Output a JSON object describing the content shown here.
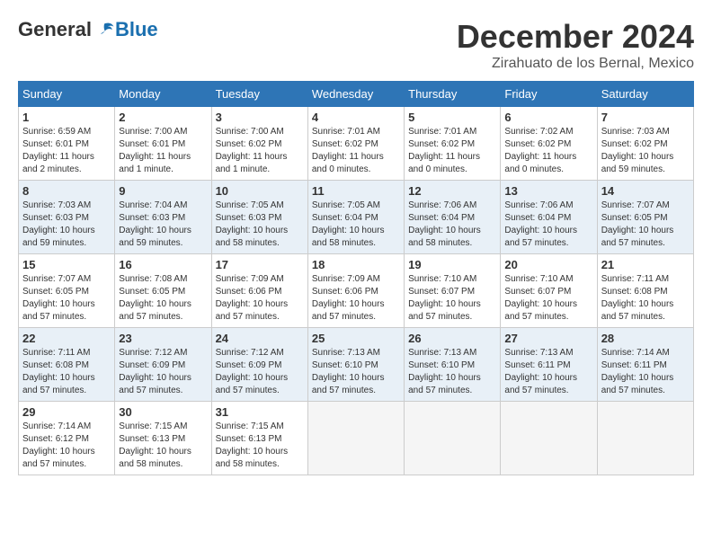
{
  "logo": {
    "general": "General",
    "blue": "Blue"
  },
  "title": "December 2024",
  "location": "Zirahuato de los Bernal, Mexico",
  "weekdays": [
    "Sunday",
    "Monday",
    "Tuesday",
    "Wednesday",
    "Thursday",
    "Friday",
    "Saturday"
  ],
  "weeks": [
    [
      {
        "day": "1",
        "sunrise": "6:59 AM",
        "sunset": "6:01 PM",
        "daylight": "11 hours and 2 minutes."
      },
      {
        "day": "2",
        "sunrise": "7:00 AM",
        "sunset": "6:01 PM",
        "daylight": "11 hours and 1 minute."
      },
      {
        "day": "3",
        "sunrise": "7:00 AM",
        "sunset": "6:02 PM",
        "daylight": "11 hours and 1 minute."
      },
      {
        "day": "4",
        "sunrise": "7:01 AM",
        "sunset": "6:02 PM",
        "daylight": "11 hours and 0 minutes."
      },
      {
        "day": "5",
        "sunrise": "7:01 AM",
        "sunset": "6:02 PM",
        "daylight": "11 hours and 0 minutes."
      },
      {
        "day": "6",
        "sunrise": "7:02 AM",
        "sunset": "6:02 PM",
        "daylight": "11 hours and 0 minutes."
      },
      {
        "day": "7",
        "sunrise": "7:03 AM",
        "sunset": "6:02 PM",
        "daylight": "10 hours and 59 minutes."
      }
    ],
    [
      {
        "day": "8",
        "sunrise": "7:03 AM",
        "sunset": "6:03 PM",
        "daylight": "10 hours and 59 minutes."
      },
      {
        "day": "9",
        "sunrise": "7:04 AM",
        "sunset": "6:03 PM",
        "daylight": "10 hours and 59 minutes."
      },
      {
        "day": "10",
        "sunrise": "7:05 AM",
        "sunset": "6:03 PM",
        "daylight": "10 hours and 58 minutes."
      },
      {
        "day": "11",
        "sunrise": "7:05 AM",
        "sunset": "6:04 PM",
        "daylight": "10 hours and 58 minutes."
      },
      {
        "day": "12",
        "sunrise": "7:06 AM",
        "sunset": "6:04 PM",
        "daylight": "10 hours and 58 minutes."
      },
      {
        "day": "13",
        "sunrise": "7:06 AM",
        "sunset": "6:04 PM",
        "daylight": "10 hours and 57 minutes."
      },
      {
        "day": "14",
        "sunrise": "7:07 AM",
        "sunset": "6:05 PM",
        "daylight": "10 hours and 57 minutes."
      }
    ],
    [
      {
        "day": "15",
        "sunrise": "7:07 AM",
        "sunset": "6:05 PM",
        "daylight": "10 hours and 57 minutes."
      },
      {
        "day": "16",
        "sunrise": "7:08 AM",
        "sunset": "6:05 PM",
        "daylight": "10 hours and 57 minutes."
      },
      {
        "day": "17",
        "sunrise": "7:09 AM",
        "sunset": "6:06 PM",
        "daylight": "10 hours and 57 minutes."
      },
      {
        "day": "18",
        "sunrise": "7:09 AM",
        "sunset": "6:06 PM",
        "daylight": "10 hours and 57 minutes."
      },
      {
        "day": "19",
        "sunrise": "7:10 AM",
        "sunset": "6:07 PM",
        "daylight": "10 hours and 57 minutes."
      },
      {
        "day": "20",
        "sunrise": "7:10 AM",
        "sunset": "6:07 PM",
        "daylight": "10 hours and 57 minutes."
      },
      {
        "day": "21",
        "sunrise": "7:11 AM",
        "sunset": "6:08 PM",
        "daylight": "10 hours and 57 minutes."
      }
    ],
    [
      {
        "day": "22",
        "sunrise": "7:11 AM",
        "sunset": "6:08 PM",
        "daylight": "10 hours and 57 minutes."
      },
      {
        "day": "23",
        "sunrise": "7:12 AM",
        "sunset": "6:09 PM",
        "daylight": "10 hours and 57 minutes."
      },
      {
        "day": "24",
        "sunrise": "7:12 AM",
        "sunset": "6:09 PM",
        "daylight": "10 hours and 57 minutes."
      },
      {
        "day": "25",
        "sunrise": "7:13 AM",
        "sunset": "6:10 PM",
        "daylight": "10 hours and 57 minutes."
      },
      {
        "day": "26",
        "sunrise": "7:13 AM",
        "sunset": "6:10 PM",
        "daylight": "10 hours and 57 minutes."
      },
      {
        "day": "27",
        "sunrise": "7:13 AM",
        "sunset": "6:11 PM",
        "daylight": "10 hours and 57 minutes."
      },
      {
        "day": "28",
        "sunrise": "7:14 AM",
        "sunset": "6:11 PM",
        "daylight": "10 hours and 57 minutes."
      }
    ],
    [
      {
        "day": "29",
        "sunrise": "7:14 AM",
        "sunset": "6:12 PM",
        "daylight": "10 hours and 57 minutes."
      },
      {
        "day": "30",
        "sunrise": "7:15 AM",
        "sunset": "6:13 PM",
        "daylight": "10 hours and 58 minutes."
      },
      {
        "day": "31",
        "sunrise": "7:15 AM",
        "sunset": "6:13 PM",
        "daylight": "10 hours and 58 minutes."
      },
      null,
      null,
      null,
      null
    ]
  ]
}
